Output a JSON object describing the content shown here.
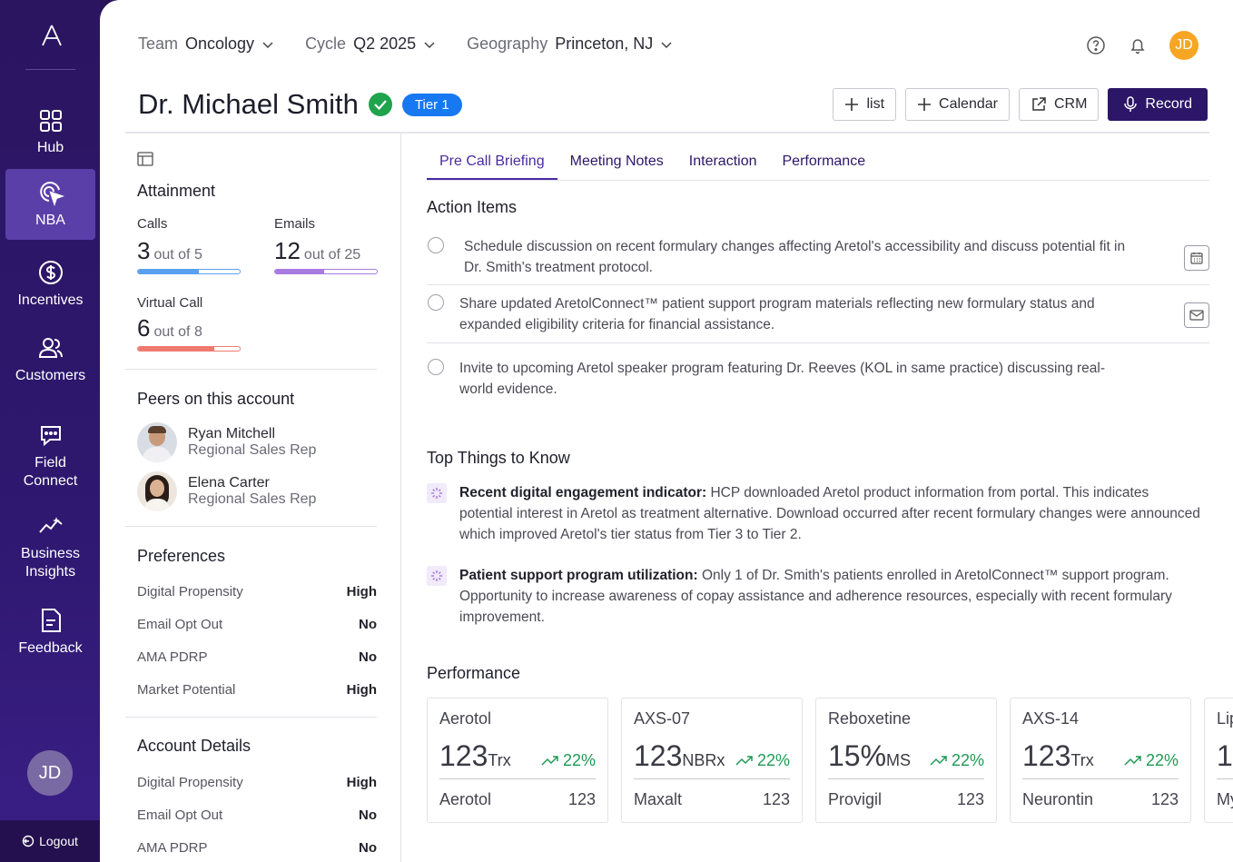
{
  "nav": {
    "items": [
      {
        "label": "Hub",
        "icon": "grid-icon"
      },
      {
        "label": "NBA",
        "icon": "target-cursor-icon"
      },
      {
        "label": "Incentives",
        "icon": "dollar-icon"
      },
      {
        "label": "Customers",
        "icon": "users-icon"
      },
      {
        "label": "Field Connect",
        "icon": "chat-icon"
      },
      {
        "label": "Business Insights",
        "icon": "trend-icon"
      },
      {
        "label": "Feedback",
        "icon": "document-icon"
      }
    ],
    "user_initials": "JD",
    "logout_label": "Logout"
  },
  "topbar": {
    "team_label": "Team",
    "team_value": "Oncology",
    "cycle_label": "Cycle",
    "cycle_value": "Q2 2025",
    "geo_label": "Geography",
    "geo_value": "Princeton, NJ",
    "user_initials": "JD"
  },
  "header": {
    "name": "Dr. Michael Smith",
    "tier": "Tier 1",
    "buttons": {
      "list": "list",
      "calendar": "Calendar",
      "crm": "CRM",
      "record": "Record"
    }
  },
  "left": {
    "attainment_title": "Attainment",
    "calls": {
      "label": "Calls",
      "value": "3",
      "sub": "out of 5",
      "fraction": 0.6
    },
    "emails": {
      "label": "Emails",
      "value": "12",
      "sub": "out of 25",
      "fraction": 0.48
    },
    "virtual": {
      "label": "Virtual Call",
      "value": "6",
      "sub": "out of 8",
      "fraction": 0.75
    },
    "peers_title": "Peers on this account",
    "peers": [
      {
        "name": "Ryan Mitchell",
        "role": "Regional Sales Rep"
      },
      {
        "name": "Elena Carter",
        "role": "Regional Sales Rep"
      }
    ],
    "preferences_title": "Preferences",
    "preferences": [
      {
        "k": "Digital Propensity",
        "v": "High"
      },
      {
        "k": "Email Opt Out",
        "v": "No"
      },
      {
        "k": "AMA PDRP",
        "v": "No"
      },
      {
        "k": "Market Potential",
        "v": "High"
      }
    ],
    "account_title": "Account Details",
    "account": [
      {
        "k": "Digital Propensity",
        "v": "High"
      },
      {
        "k": "Email Opt Out",
        "v": "No"
      },
      {
        "k": "AMA PDRP",
        "v": "No"
      }
    ]
  },
  "tabs": [
    "Pre Call Briefing",
    "Meeting Notes",
    "Interaction",
    "Performance"
  ],
  "action_items_title": "Action Items",
  "action_items": [
    "Schedule discussion on recent formulary changes affecting Aretol's accessibility and discuss potential fit in Dr. Smith's treatment protocol.",
    "Share updated AretolConnect™ patient support program materials reflecting new formulary status and expanded eligibility criteria for financial assistance.",
    "Invite to upcoming Aretol speaker program featuring Dr. Reeves  (KOL in same practice) discussing real-world evidence."
  ],
  "top_things_title": "Top Things to Know",
  "top_things": [
    {
      "bold": "Recent digital engagement indicator:",
      "text": " HCP downloaded Aretol product information from portal. This indicates potential interest in Aretol as treatment alternative. Download occurred after recent formulary changes were announced which improved Aretol's tier status from Tier 3 to Tier 2."
    },
    {
      "bold": "Patient support program utilization:",
      "text": " Only 1 of Dr. Smith's patients enrolled in AretolConnect™ support program. Opportunity to increase awareness of copay assistance and adherence resources, especially with recent formulary improvement."
    }
  ],
  "performance_title": "Performance",
  "cards": [
    {
      "name": "Aerotol",
      "value": "123",
      "unit": "Trx",
      "delta": "22%",
      "foot_name": "Aerotol",
      "foot_value": "123"
    },
    {
      "name": "AXS-07",
      "value": "123",
      "unit": "NBRx",
      "delta": "22%",
      "foot_name": "Maxalt",
      "foot_value": "123"
    },
    {
      "name": "Reboxetine",
      "value": "15%",
      "unit": "MS",
      "delta": "22%",
      "foot_name": "Provigil",
      "foot_value": "123"
    },
    {
      "name": "AXS-14",
      "value": "123",
      "unit": "Trx",
      "delta": "22%",
      "foot_name": "Neurontin",
      "foot_value": "123"
    },
    {
      "name": "Lip",
      "value": "1",
      "unit": "",
      "delta": "",
      "foot_name": "My",
      "foot_value": ""
    }
  ],
  "colors": {
    "sidebar": "#2b1560",
    "accent": "#4a2aa0",
    "tier": "#1778f2",
    "record": "#2c1668",
    "calls_bar": "#5aa0f0",
    "emails_bar": "#a77be0",
    "virtual_bar": "#f07a70",
    "delta": "#1f9a55"
  }
}
